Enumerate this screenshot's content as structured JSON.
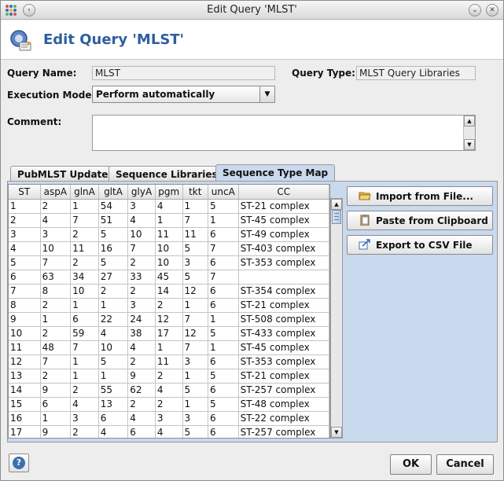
{
  "window": {
    "title": "Edit Query 'MLST'"
  },
  "header": {
    "title": "Edit Query 'MLST'"
  },
  "form": {
    "query_name_label": "Query Name:",
    "query_name_value": "MLST",
    "query_type_label": "Query Type:",
    "query_type_value": "MLST Query Libraries",
    "execution_mode_label": "Execution Mode:",
    "execution_mode_value": "Perform automatically",
    "comment_label": "Comment:",
    "comment_value": ""
  },
  "tabs": [
    {
      "label": "PubMLST Update",
      "active": false
    },
    {
      "label": "Sequence Libraries",
      "active": false
    },
    {
      "label": "Sequence Type Map",
      "active": true
    }
  ],
  "table": {
    "columns": [
      "ST",
      "aspA",
      "glnA",
      "gltA",
      "glyA",
      "pgm",
      "tkt",
      "uncA",
      "CC"
    ],
    "rows": [
      [
        "1",
        "2",
        "1",
        "54",
        "3",
        "4",
        "1",
        "5",
        "ST-21 complex"
      ],
      [
        "2",
        "4",
        "7",
        "51",
        "4",
        "1",
        "7",
        "1",
        "ST-45 complex"
      ],
      [
        "3",
        "3",
        "2",
        "5",
        "10",
        "11",
        "11",
        "6",
        "ST-49 complex"
      ],
      [
        "4",
        "10",
        "11",
        "16",
        "7",
        "10",
        "5",
        "7",
        "ST-403 complex"
      ],
      [
        "5",
        "7",
        "2",
        "5",
        "2",
        "10",
        "3",
        "6",
        "ST-353 complex"
      ],
      [
        "6",
        "63",
        "34",
        "27",
        "33",
        "45",
        "5",
        "7",
        ""
      ],
      [
        "7",
        "8",
        "10",
        "2",
        "2",
        "14",
        "12",
        "6",
        "ST-354 complex"
      ],
      [
        "8",
        "2",
        "1",
        "1",
        "3",
        "2",
        "1",
        "6",
        "ST-21 complex"
      ],
      [
        "9",
        "1",
        "6",
        "22",
        "24",
        "12",
        "7",
        "1",
        "ST-508 complex"
      ],
      [
        "10",
        "2",
        "59",
        "4",
        "38",
        "17",
        "12",
        "5",
        "ST-433 complex"
      ],
      [
        "11",
        "48",
        "7",
        "10",
        "4",
        "1",
        "7",
        "1",
        "ST-45 complex"
      ],
      [
        "12",
        "7",
        "1",
        "5",
        "2",
        "11",
        "3",
        "6",
        "ST-353 complex"
      ],
      [
        "13",
        "2",
        "1",
        "1",
        "9",
        "2",
        "1",
        "5",
        "ST-21 complex"
      ],
      [
        "14",
        "9",
        "2",
        "55",
        "62",
        "4",
        "5",
        "6",
        "ST-257 complex"
      ],
      [
        "15",
        "6",
        "4",
        "13",
        "2",
        "2",
        "1",
        "5",
        "ST-48 complex"
      ],
      [
        "16",
        "1",
        "3",
        "6",
        "4",
        "3",
        "3",
        "6",
        "ST-22 complex"
      ],
      [
        "17",
        "9",
        "2",
        "4",
        "6",
        "4",
        "5",
        "6",
        "ST-257 complex"
      ]
    ]
  },
  "actions": {
    "import_label": "Import from File...",
    "paste_label": "Paste from Clipboard",
    "export_label": "Export to CSV File"
  },
  "footer": {
    "ok_label": "OK",
    "cancel_label": "Cancel",
    "help_glyph": "?"
  },
  "icons": {
    "app": "app-grid-icon",
    "header": "query-edit-icon",
    "import": "folder-open-icon",
    "paste": "clipboard-icon",
    "export": "export-icon",
    "help": "help-icon"
  },
  "colors": {
    "accent": "#2e5f9e",
    "tab_panel": "#c9d9ee"
  }
}
